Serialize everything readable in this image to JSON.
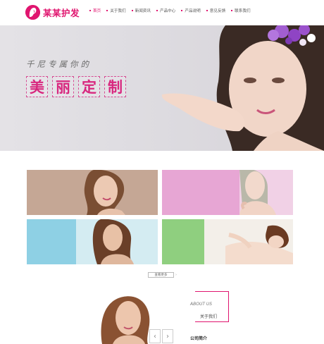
{
  "brand": {
    "name": "某某护发",
    "accent": "#e0156f"
  },
  "nav": {
    "items": [
      {
        "label": "首页",
        "active": true
      },
      {
        "label": "关于我们"
      },
      {
        "label": "新闻资讯"
      },
      {
        "label": "产品中心"
      },
      {
        "label": "产品说明"
      },
      {
        "label": "意见反馈"
      },
      {
        "label": "联系我们"
      }
    ]
  },
  "banner": {
    "slogan_small": "千尼专属你的",
    "slogan_chars": [
      "美",
      "丽",
      "定",
      "制"
    ],
    "slides_total": 2,
    "active_slide": 1
  },
  "gallery": {
    "more_label": "查看更多"
  },
  "about": {
    "heading_en": "ABOUT US",
    "heading_cn": "关于我们",
    "company_label": "公司简介"
  },
  "icons": {
    "logo": "woman-silhouette-icon",
    "prev": "chevron-left-icon",
    "next": "chevron-right-icon",
    "more_arrow": "arrow-right-icon"
  }
}
